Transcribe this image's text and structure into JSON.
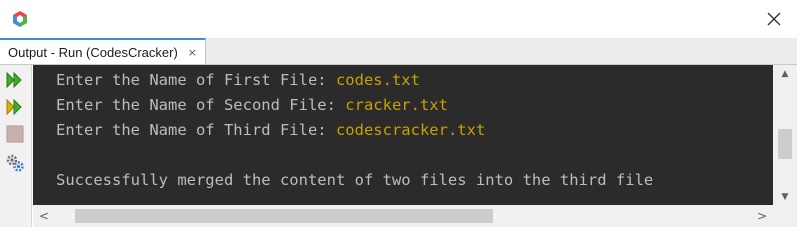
{
  "window": {
    "app_icon": "netbeans-cube-icon",
    "close_icon": "close-icon"
  },
  "tab": {
    "label": "Output - Run (CodesCracker)",
    "close_label": "×"
  },
  "toolbar": {
    "items": [
      {
        "icon": "rerun-icon"
      },
      {
        "icon": "rerun-with-arguments-icon"
      },
      {
        "icon": "stop-icon"
      },
      {
        "icon": "settings-icon"
      }
    ]
  },
  "console": {
    "lines": [
      {
        "prompt": "Enter the Name of First File: ",
        "input": "codes.txt"
      },
      {
        "prompt": "Enter the Name of Second File: ",
        "input": "cracker.txt"
      },
      {
        "prompt": "Enter the Name of Third File: ",
        "input": "codescracker.txt"
      },
      {
        "prompt": "",
        "input": ""
      },
      {
        "prompt": "Successfully merged the content of two files into the third file",
        "input": ""
      }
    ],
    "colors": {
      "background": "#2b2b2b",
      "text": "#bcbcbc",
      "user_input": "#c8a000"
    }
  },
  "scrollbars": {
    "up_arrow": "▲",
    "down_arrow": "▼",
    "left_arrow": "<",
    "right_arrow": ">"
  }
}
